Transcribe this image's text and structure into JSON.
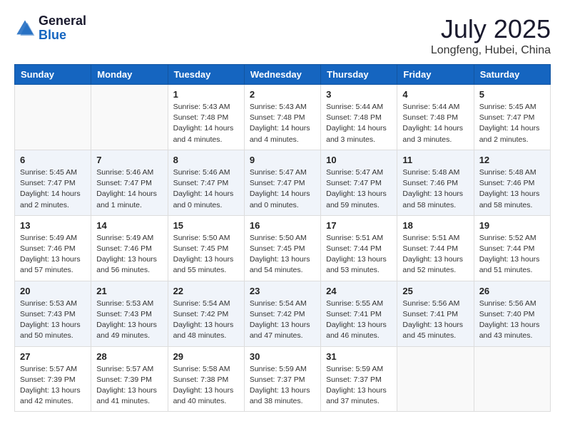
{
  "header": {
    "logo_general": "General",
    "logo_blue": "Blue",
    "month_title": "July 2025",
    "location": "Longfeng, Hubei, China"
  },
  "weekdays": [
    "Sunday",
    "Monday",
    "Tuesday",
    "Wednesday",
    "Thursday",
    "Friday",
    "Saturday"
  ],
  "weeks": [
    [
      {
        "day": "",
        "sunrise": "",
        "sunset": "",
        "daylight": ""
      },
      {
        "day": "",
        "sunrise": "",
        "sunset": "",
        "daylight": ""
      },
      {
        "day": "1",
        "sunrise": "Sunrise: 5:43 AM",
        "sunset": "Sunset: 7:48 PM",
        "daylight": "Daylight: 14 hours and 4 minutes."
      },
      {
        "day": "2",
        "sunrise": "Sunrise: 5:43 AM",
        "sunset": "Sunset: 7:48 PM",
        "daylight": "Daylight: 14 hours and 4 minutes."
      },
      {
        "day": "3",
        "sunrise": "Sunrise: 5:44 AM",
        "sunset": "Sunset: 7:48 PM",
        "daylight": "Daylight: 14 hours and 3 minutes."
      },
      {
        "day": "4",
        "sunrise": "Sunrise: 5:44 AM",
        "sunset": "Sunset: 7:48 PM",
        "daylight": "Daylight: 14 hours and 3 minutes."
      },
      {
        "day": "5",
        "sunrise": "Sunrise: 5:45 AM",
        "sunset": "Sunset: 7:47 PM",
        "daylight": "Daylight: 14 hours and 2 minutes."
      }
    ],
    [
      {
        "day": "6",
        "sunrise": "Sunrise: 5:45 AM",
        "sunset": "Sunset: 7:47 PM",
        "daylight": "Daylight: 14 hours and 2 minutes."
      },
      {
        "day": "7",
        "sunrise": "Sunrise: 5:46 AM",
        "sunset": "Sunset: 7:47 PM",
        "daylight": "Daylight: 14 hours and 1 minute."
      },
      {
        "day": "8",
        "sunrise": "Sunrise: 5:46 AM",
        "sunset": "Sunset: 7:47 PM",
        "daylight": "Daylight: 14 hours and 0 minutes."
      },
      {
        "day": "9",
        "sunrise": "Sunrise: 5:47 AM",
        "sunset": "Sunset: 7:47 PM",
        "daylight": "Daylight: 14 hours and 0 minutes."
      },
      {
        "day": "10",
        "sunrise": "Sunrise: 5:47 AM",
        "sunset": "Sunset: 7:47 PM",
        "daylight": "Daylight: 13 hours and 59 minutes."
      },
      {
        "day": "11",
        "sunrise": "Sunrise: 5:48 AM",
        "sunset": "Sunset: 7:46 PM",
        "daylight": "Daylight: 13 hours and 58 minutes."
      },
      {
        "day": "12",
        "sunrise": "Sunrise: 5:48 AM",
        "sunset": "Sunset: 7:46 PM",
        "daylight": "Daylight: 13 hours and 58 minutes."
      }
    ],
    [
      {
        "day": "13",
        "sunrise": "Sunrise: 5:49 AM",
        "sunset": "Sunset: 7:46 PM",
        "daylight": "Daylight: 13 hours and 57 minutes."
      },
      {
        "day": "14",
        "sunrise": "Sunrise: 5:49 AM",
        "sunset": "Sunset: 7:46 PM",
        "daylight": "Daylight: 13 hours and 56 minutes."
      },
      {
        "day": "15",
        "sunrise": "Sunrise: 5:50 AM",
        "sunset": "Sunset: 7:45 PM",
        "daylight": "Daylight: 13 hours and 55 minutes."
      },
      {
        "day": "16",
        "sunrise": "Sunrise: 5:50 AM",
        "sunset": "Sunset: 7:45 PM",
        "daylight": "Daylight: 13 hours and 54 minutes."
      },
      {
        "day": "17",
        "sunrise": "Sunrise: 5:51 AM",
        "sunset": "Sunset: 7:44 PM",
        "daylight": "Daylight: 13 hours and 53 minutes."
      },
      {
        "day": "18",
        "sunrise": "Sunrise: 5:51 AM",
        "sunset": "Sunset: 7:44 PM",
        "daylight": "Daylight: 13 hours and 52 minutes."
      },
      {
        "day": "19",
        "sunrise": "Sunrise: 5:52 AM",
        "sunset": "Sunset: 7:44 PM",
        "daylight": "Daylight: 13 hours and 51 minutes."
      }
    ],
    [
      {
        "day": "20",
        "sunrise": "Sunrise: 5:53 AM",
        "sunset": "Sunset: 7:43 PM",
        "daylight": "Daylight: 13 hours and 50 minutes."
      },
      {
        "day": "21",
        "sunrise": "Sunrise: 5:53 AM",
        "sunset": "Sunset: 7:43 PM",
        "daylight": "Daylight: 13 hours and 49 minutes."
      },
      {
        "day": "22",
        "sunrise": "Sunrise: 5:54 AM",
        "sunset": "Sunset: 7:42 PM",
        "daylight": "Daylight: 13 hours and 48 minutes."
      },
      {
        "day": "23",
        "sunrise": "Sunrise: 5:54 AM",
        "sunset": "Sunset: 7:42 PM",
        "daylight": "Daylight: 13 hours and 47 minutes."
      },
      {
        "day": "24",
        "sunrise": "Sunrise: 5:55 AM",
        "sunset": "Sunset: 7:41 PM",
        "daylight": "Daylight: 13 hours and 46 minutes."
      },
      {
        "day": "25",
        "sunrise": "Sunrise: 5:56 AM",
        "sunset": "Sunset: 7:41 PM",
        "daylight": "Daylight: 13 hours and 45 minutes."
      },
      {
        "day": "26",
        "sunrise": "Sunrise: 5:56 AM",
        "sunset": "Sunset: 7:40 PM",
        "daylight": "Daylight: 13 hours and 43 minutes."
      }
    ],
    [
      {
        "day": "27",
        "sunrise": "Sunrise: 5:57 AM",
        "sunset": "Sunset: 7:39 PM",
        "daylight": "Daylight: 13 hours and 42 minutes."
      },
      {
        "day": "28",
        "sunrise": "Sunrise: 5:57 AM",
        "sunset": "Sunset: 7:39 PM",
        "daylight": "Daylight: 13 hours and 41 minutes."
      },
      {
        "day": "29",
        "sunrise": "Sunrise: 5:58 AM",
        "sunset": "Sunset: 7:38 PM",
        "daylight": "Daylight: 13 hours and 40 minutes."
      },
      {
        "day": "30",
        "sunrise": "Sunrise: 5:59 AM",
        "sunset": "Sunset: 7:37 PM",
        "daylight": "Daylight: 13 hours and 38 minutes."
      },
      {
        "day": "31",
        "sunrise": "Sunrise: 5:59 AM",
        "sunset": "Sunset: 7:37 PM",
        "daylight": "Daylight: 13 hours and 37 minutes."
      },
      {
        "day": "",
        "sunrise": "",
        "sunset": "",
        "daylight": ""
      },
      {
        "day": "",
        "sunrise": "",
        "sunset": "",
        "daylight": ""
      }
    ]
  ]
}
